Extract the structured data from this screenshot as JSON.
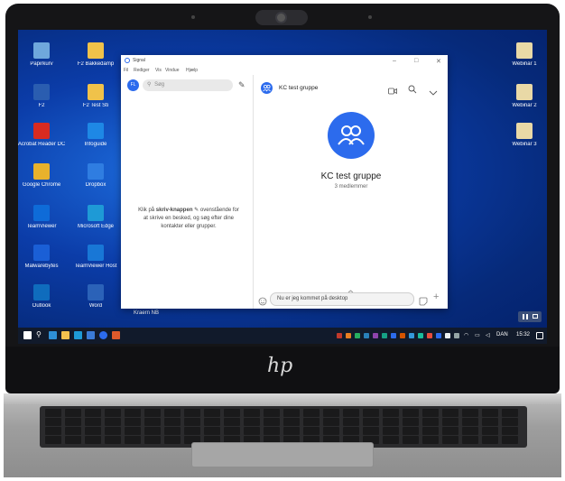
{
  "window": {
    "title": "Signal",
    "menu": [
      "Fil",
      "Rediger",
      "Vis",
      "Vindue",
      "Hjælp"
    ],
    "min": "–",
    "max": "□",
    "close": "✕"
  },
  "left_pane": {
    "avatar_initials": "FL",
    "search_placeholder": "Søg",
    "empty_before": "Klik på ",
    "empty_bold": "skriv-knappen",
    "empty_after": " ovenstående for at skrive en besked, og søg efter dine kontakter eller grupper."
  },
  "conversation": {
    "name": "KC test gruppe",
    "big_name": "KC test gruppe",
    "member_count": "3 medlemmer",
    "message_placeholder": "Nu er jeg kommet på desktop"
  },
  "desktop_icons_left": [
    {
      "label": "Papirkurv",
      "color": "#6fa8dc"
    },
    {
      "label": "F2",
      "color": "#2a5db0"
    },
    {
      "label": "Acrobat Reader DC",
      "color": "#d82b20"
    },
    {
      "label": "Google Chrome",
      "color": "#e8b22c"
    },
    {
      "label": "TeamViewer",
      "color": "#0e6bd8"
    },
    {
      "label": "Malwarebytes",
      "color": "#1a5fd6"
    },
    {
      "label": "Outlook",
      "color": "#0f6cbd"
    }
  ],
  "desktop_icons_col2": [
    {
      "label": "F2 Bakkedamp",
      "color": "#f0c24a"
    },
    {
      "label": "F2 Test Sti",
      "color": "#f0c24a"
    },
    {
      "label": "Infoguide",
      "color": "#1e88e5"
    },
    {
      "label": "Dropbox",
      "color": "#2f7de1"
    },
    {
      "label": "Microsoft Edge",
      "color": "#1e9ad6"
    },
    {
      "label": "TeamViewer Host",
      "color": "#1877d6"
    },
    {
      "label": "Word",
      "color": "#2b62b8"
    }
  ],
  "desktop_icons_right": [
    {
      "label": "Webinar 1",
      "color": "#e9d9a6"
    },
    {
      "label": "Webinar 2",
      "color": "#e9d9a6"
    },
    {
      "label": "Webinar 3",
      "color": "#e9d9a6"
    }
  ],
  "extra_label": "Kraern NB",
  "taskbar": {
    "lang": "DAN",
    "time": "15:32"
  },
  "brand": "hp"
}
